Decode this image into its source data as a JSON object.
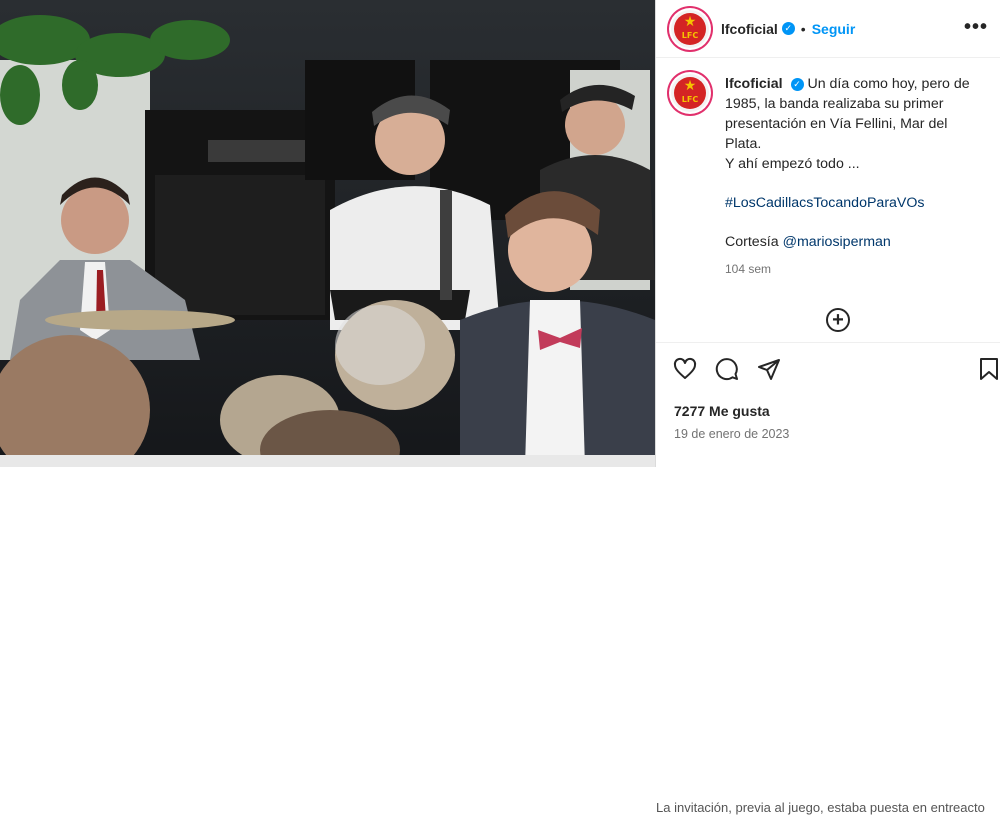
{
  "post": {
    "username": "lfcoficial",
    "follow_label": "Seguir",
    "separator": "•",
    "more_label": "•••",
    "avatar_text": "LFC",
    "caption_line1": "Un día como hoy, pero de 1985, la banda realizaba su primer presentación en Vía Fellini, Mar del Plata.",
    "caption_line2": "Y ahí empezó todo ...",
    "hashtag": "#LosCadillacsTocandoParaVOs",
    "courtesy_prefix": "Cortesía ",
    "courtesy_mention": "@mariosiperman",
    "relative_time": "104 sem",
    "likes": "7277 Me gusta",
    "date": "19 de enero de 2023",
    "next_comment_peek": "La invitación, previa al juego, estaba puesta en entreacto"
  },
  "colors": {
    "accent": "#0095f6",
    "link": "#00376b",
    "text": "#262626",
    "muted": "#737373",
    "logo_red": "#d42424",
    "logo_yellow": "#f5c400"
  },
  "icons": [
    "verified-badge-icon",
    "more-options-icon",
    "add-comment-icon",
    "heart-icon",
    "comment-icon",
    "share-icon",
    "bookmark-icon"
  ]
}
